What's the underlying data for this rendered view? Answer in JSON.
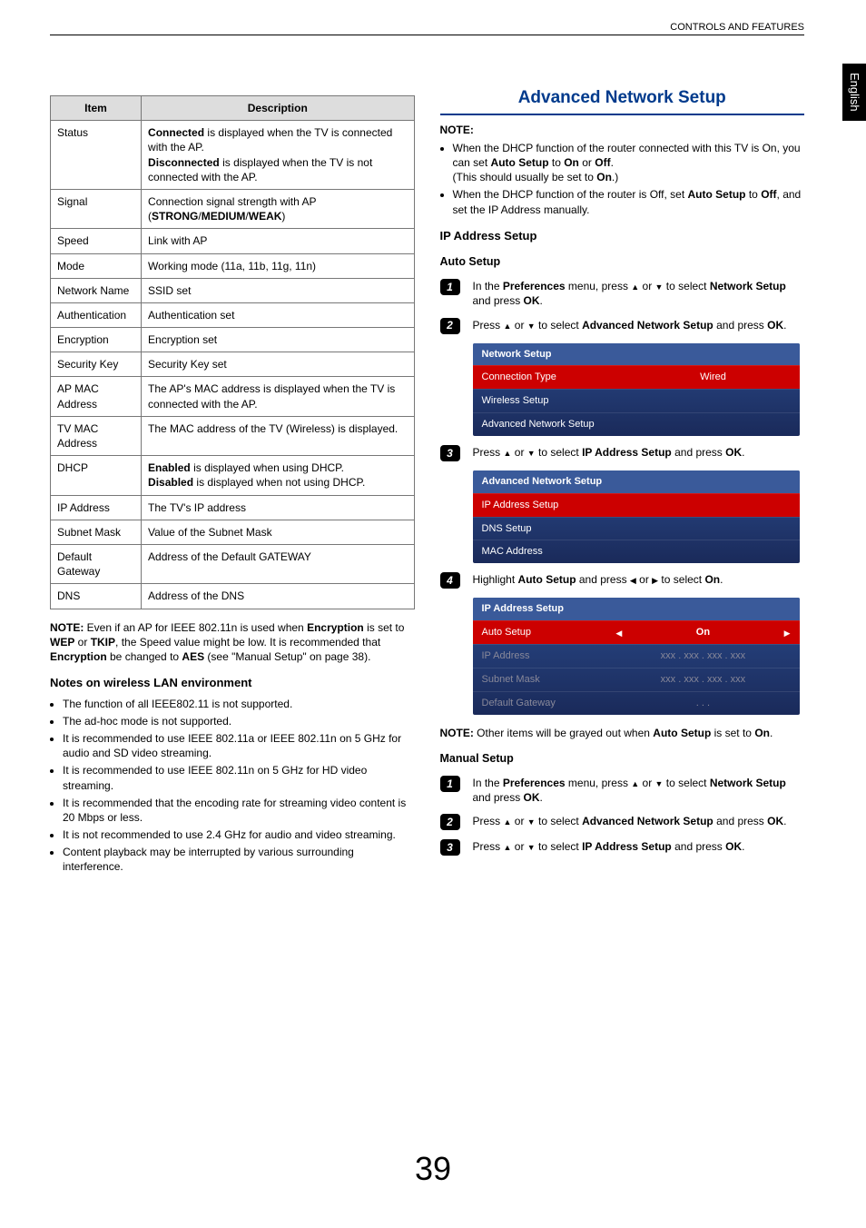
{
  "header": {
    "breadcrumb": "CONTROLS AND FEATURES"
  },
  "side_tab": "English",
  "page_number": "39",
  "table": {
    "head_item": "Item",
    "head_desc": "Description",
    "rows": [
      {
        "item": "Status",
        "desc_prefix1": "Connected",
        "desc_mid1": " is displayed when the TV is connected with the AP.",
        "desc_prefix2": "Disconnected",
        "desc_mid2": " is displayed when the TV is not connected with the AP."
      },
      {
        "item": "Signal",
        "desc_plain_a": "Connection signal strength with AP (",
        "desc_bold": "STRONG",
        "desc_sep1": "/",
        "desc_bold2": "MEDIUM",
        "desc_sep2": "/",
        "desc_bold3": "WEAK",
        "desc_plain_b": ")"
      },
      {
        "item": "Speed",
        "desc": "Link with AP"
      },
      {
        "item": "Mode",
        "desc": "Working mode (11a, 11b, 11g, 11n)"
      },
      {
        "item": "Network Name",
        "desc": "SSID set"
      },
      {
        "item": "Authentication",
        "desc": "Authentication set"
      },
      {
        "item": "Encryption",
        "desc": "Encryption set"
      },
      {
        "item": "Security Key",
        "desc": "Security Key set"
      },
      {
        "item": "AP MAC Address",
        "desc": "The AP's MAC address is displayed when the TV is connected with the AP."
      },
      {
        "item": "TV MAC Address",
        "desc": "The MAC address of the TV (Wireless) is displayed."
      },
      {
        "item": "DHCP",
        "desc_prefix1": "Enabled",
        "desc_mid1": " is displayed when using DHCP.",
        "desc_prefix2": "Disabled",
        "desc_mid2": " is displayed when not using DHCP."
      },
      {
        "item": "IP Address",
        "desc": "The TV's IP address"
      },
      {
        "item": "Subnet Mask",
        "desc": "Value of the Subnet Mask"
      },
      {
        "item": "Default Gateway",
        "desc": "Address of the Default GATEWAY"
      },
      {
        "item": "DNS",
        "desc": "Address of the DNS"
      }
    ]
  },
  "left_note": {
    "label": "NOTE:",
    "t1": " Even if an AP for IEEE 802.11n is used when ",
    "b1": "Encryption",
    "t2": " is set to ",
    "b2": "WEP",
    "t3": " or ",
    "b3": "TKIP",
    "t4": ", the Speed value might be low. It is recommended that ",
    "b4": "Encryption",
    "t5": " be changed to ",
    "b5": "AES",
    "t6": " (see \"Manual Setup\" on page 38)."
  },
  "lan_heading": "Notes on wireless LAN environment",
  "lan_bullets": [
    "The function of all IEEE802.11 is not supported.",
    "The ad-hoc mode is not supported.",
    "It is recommended to use IEEE 802.11a or IEEE 802.11n on 5 GHz for audio and SD video streaming.",
    "It is recommended to use IEEE 802.11n on 5 GHz for HD video streaming.",
    "It is recommended that the encoding rate for streaming video content is 20 Mbps or less.",
    "It is not recommended to use 2.4 GHz for audio and video streaming.",
    "Content playback may be interrupted by various surrounding interference."
  ],
  "right": {
    "title": "Advanced Network Setup",
    "note_label": "NOTE:",
    "note_b1a": "When the DHCP function of the router connected with this TV is On, you can set ",
    "note_b1b": "Auto Setup",
    "note_b1c": " to ",
    "note_b1d": "On",
    "note_b1e": " or ",
    "note_b1f": "Off",
    "note_b1g": ".",
    "note_b1h": "(This should usually be set to ",
    "note_b1i": "On",
    "note_b1j": ".)",
    "note_b2a": "When the DHCP function of the router is Off, set ",
    "note_b2b": "Auto Setup",
    "note_b2c": " to ",
    "note_b2d": "Off",
    "note_b2e": ", and set the IP Address manually.",
    "ip_heading": "IP Address Setup",
    "auto_heading": "Auto Setup",
    "step1a": "In the ",
    "step1b": "Preferences",
    "step1c": " menu, press ",
    "step1d": " or ",
    "step1e": " to select ",
    "step1f": "Network Setup",
    "step1g": " and press ",
    "step1h": "OK",
    "step1i": ".",
    "step2a": "Press ",
    "step2b": " or ",
    "step2c": " to select ",
    "step2d": "Advanced Network Setup",
    "step2e": " and press ",
    "step2f": "OK",
    "step2g": ".",
    "osd1": {
      "title": "Network Setup",
      "r1l": "Connection Type",
      "r1r": "Wired",
      "r2": "Wireless Setup",
      "r3": "Advanced Network Setup"
    },
    "step3a": "Press ",
    "step3b": " or ",
    "step3c": " to select ",
    "step3d": "IP Address Setup",
    "step3e": " and press ",
    "step3f": "OK",
    "step3g": ".",
    "osd2": {
      "title": "Advanced Network Setup",
      "r1": "IP Address Setup",
      "r2": "DNS Setup",
      "r3": "MAC Address"
    },
    "step4a": "Highlight ",
    "step4b": "Auto Setup",
    "step4c": " and press ",
    "step4d": " or ",
    "step4e": " to select ",
    "step4f": "On",
    "step4g": ".",
    "osd3": {
      "title": "IP Address Setup",
      "r1l": "Auto Setup",
      "r1r": "On",
      "r2l": "IP Address",
      "r2r": "xxx   .   xxx   .   xxx   .   xxx",
      "r3l": "Subnet Mask",
      "r3r": "xxx   .   xxx   .   xxx   .   xxx",
      "r4l": "Default Gateway",
      "r4r": ".          .          ."
    },
    "note2a": "NOTE:",
    "note2b": " Other items will be grayed out when ",
    "note2c": "Auto Setup",
    "note2d": " is set to ",
    "note2e": "On",
    "note2f": ".",
    "manual_heading": "Manual Setup",
    "m1a": "In the ",
    "m1b": "Preferences",
    "m1c": " menu, press ",
    "m1d": " or ",
    "m1e": " to select ",
    "m1f": "Network Setup",
    "m1g": " and press ",
    "m1h": "OK",
    "m1i": ".",
    "m2a": "Press ",
    "m2b": " or ",
    "m2c": " to select ",
    "m2d": "Advanced Network Setup",
    "m2e": " and press ",
    "m2f": "OK",
    "m2g": ".",
    "m3a": "Press ",
    "m3b": " or ",
    "m3c": " to select ",
    "m3d": "IP Address Setup",
    "m3e": " and press ",
    "m3f": "OK",
    "m3g": "."
  }
}
